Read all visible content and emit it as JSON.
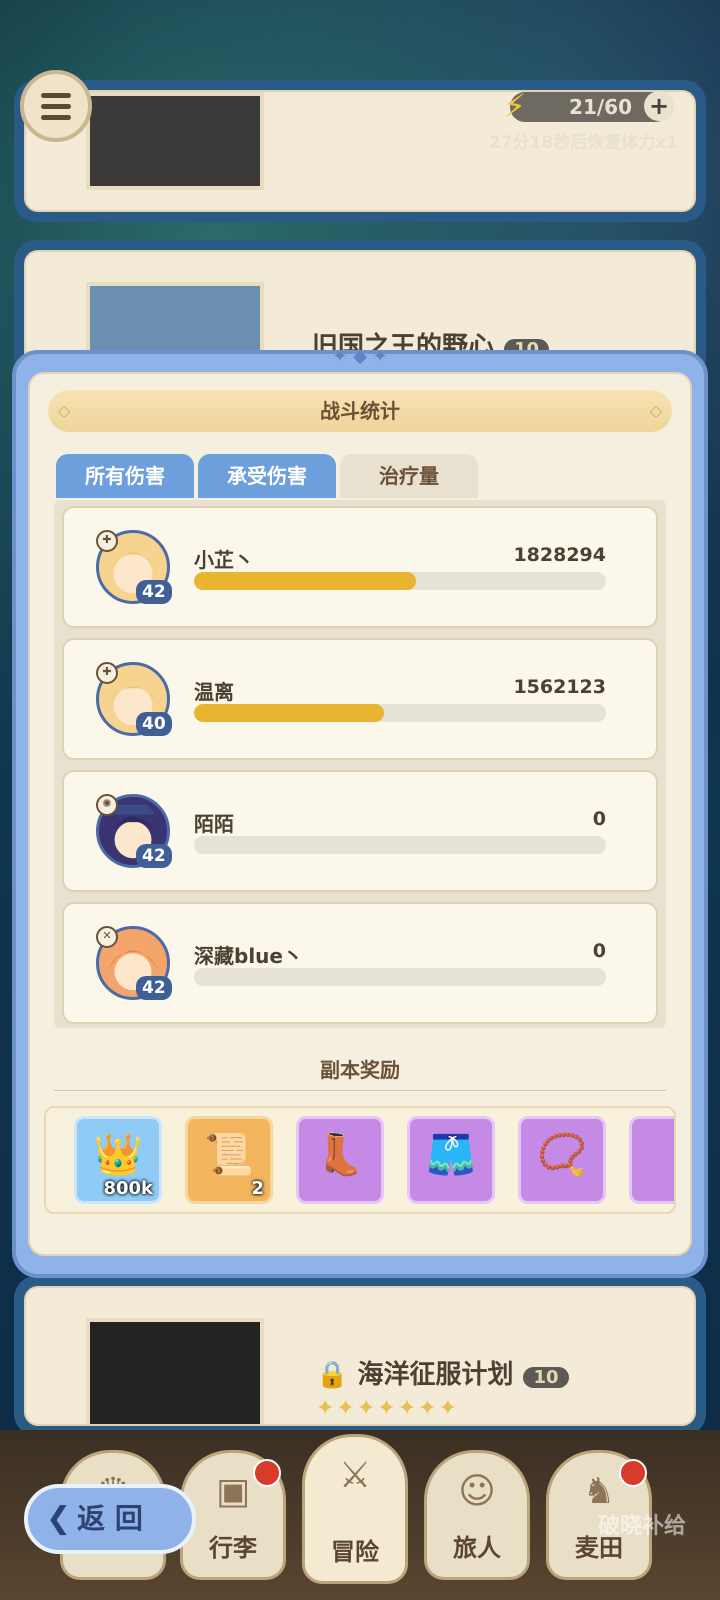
{
  "hud": {
    "stamina": "21/60",
    "stamina_plus": "+",
    "recover_text": "27分18秒后恢复体力x1"
  },
  "background_cards": [
    {
      "title": "旧国之王的野心",
      "badge": "10"
    },
    {
      "title": "海洋征服计划",
      "badge": "10"
    }
  ],
  "modal": {
    "title": "战斗统计",
    "tabs": [
      "所有伤害",
      "承受伤害",
      "治疗量"
    ],
    "players": [
      {
        "name": "小芷丶",
        "value": "1828294",
        "level": "42",
        "fill": 0.54
      },
      {
        "name": "温离",
        "value": "1562123",
        "level": "40",
        "fill": 0.46
      },
      {
        "name": "陌陌",
        "value": "0",
        "level": "42",
        "fill": 0
      },
      {
        "name": "深藏blue丶",
        "value": "0",
        "level": "42",
        "fill": 0
      }
    ],
    "reward_title": "副本奖励",
    "rewards": [
      {
        "icon": "crown-icon",
        "count": "800k",
        "rarity": "blue"
      },
      {
        "icon": "paper-icon",
        "count": "2",
        "rarity": "orange"
      },
      {
        "icon": "boots-icon",
        "count": "",
        "rarity": "purple"
      },
      {
        "icon": "belt-icon",
        "count": "",
        "rarity": "purple"
      },
      {
        "icon": "necklace-icon",
        "count": "",
        "rarity": "purple"
      }
    ]
  },
  "nav": {
    "items": [
      "行李",
      "冒险",
      "旅人",
      "麦田"
    ],
    "back_label": "返 回",
    "watermark": "破晓补给"
  },
  "colors": {
    "accent_blue": "#6d9fdd",
    "bar_fill": "#e9b530",
    "panel_bg": "#f5efe0"
  }
}
